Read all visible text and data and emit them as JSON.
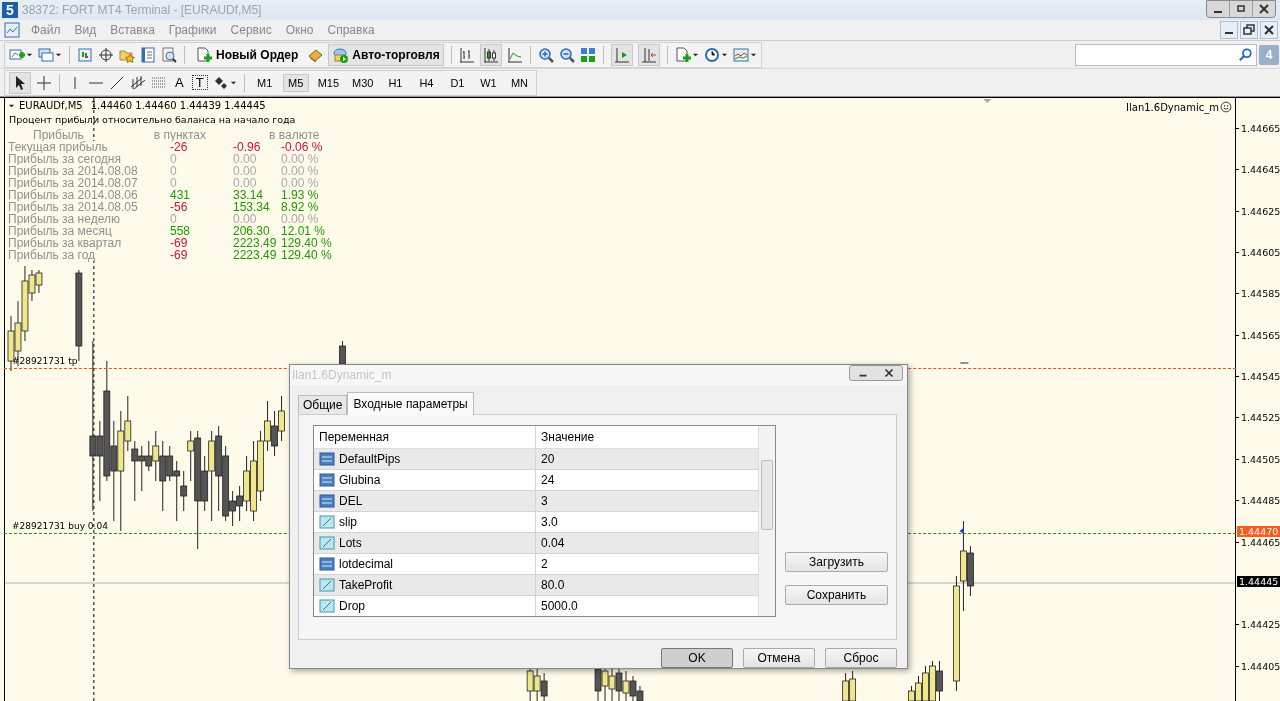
{
  "window": {
    "logo": "5",
    "title": "38372: FORT MT4 Terminal - [EURAUDf,M5]"
  },
  "menu": [
    "Файл",
    "Вид",
    "Вставка",
    "Графики",
    "Сервис",
    "Окно",
    "Справка"
  ],
  "toolbar": {
    "new_order": "Новый Ордер",
    "auto_trading": {
      "label": "Авто-торговля",
      "on": true
    },
    "messages_badge": "4"
  },
  "text_tools": [
    "A",
    "T"
  ],
  "timeframes": [
    {
      "label": "M1",
      "selected": false
    },
    {
      "label": "M5",
      "selected": true
    },
    {
      "label": "M15",
      "selected": false
    },
    {
      "label": "M30",
      "selected": false
    },
    {
      "label": "H1",
      "selected": false
    },
    {
      "label": "H4",
      "selected": false
    },
    {
      "label": "D1",
      "selected": false
    },
    {
      "label": "W1",
      "selected": false
    },
    {
      "label": "MN",
      "selected": false
    }
  ],
  "chart": {
    "symbol": "EURAUDf,M5",
    "ohlc": "1.44460 1.44460 1.44439 1.44445",
    "expert": "Ilan1.6Dynamic_m",
    "subtitle": "Процент прибыли относительно баланса на начало года",
    "profit_headers": [
      "Прибыль",
      "в пунктах",
      "в валюте"
    ],
    "profit_rows": [
      {
        "label": "Текущая прибыль",
        "cells": [
          {
            "text": "-26",
            "color": "#d0103a"
          },
          {
            "text": "-0.96",
            "color": "#d0103a"
          },
          {
            "text": "-0.06 %",
            "color": "#d0103a"
          }
        ]
      },
      {
        "label": "Прибыль за сегодня",
        "cells": [
          {
            "text": "0",
            "color": "#a8a8a8"
          },
          {
            "text": "0.00",
            "color": "#a8a8a8"
          },
          {
            "text": "0.00 %",
            "color": "#a8a8a8"
          }
        ]
      },
      {
        "label": "Прибыль за 2014.08.08",
        "cells": [
          {
            "text": "0",
            "color": "#a8a8a8"
          },
          {
            "text": "0.00",
            "color": "#a8a8a8"
          },
          {
            "text": "0.00 %",
            "color": "#a8a8a8"
          }
        ]
      },
      {
        "label": "Прибыль за 2014.08.07",
        "cells": [
          {
            "text": "0",
            "color": "#a8a8a8"
          },
          {
            "text": "0.00",
            "color": "#a8a8a8"
          },
          {
            "text": "0.00 %",
            "color": "#a8a8a8"
          }
        ]
      },
      {
        "label": "Прибыль за 2014.08.06",
        "cells": [
          {
            "text": "431",
            "color": "#1e9a00"
          },
          {
            "text": "33.14",
            "color": "#1e9a00"
          },
          {
            "text": "1.93 %",
            "color": "#1e9a00"
          }
        ]
      },
      {
        "label": "Прибыль за 2014.08.05",
        "cells": [
          {
            "text": "-56",
            "color": "#d0103a"
          },
          {
            "text": "153.34",
            "color": "#1e9a00"
          },
          {
            "text": "8.92 %",
            "color": "#1e9a00"
          }
        ]
      },
      {
        "label": "Прибыль за неделю",
        "cells": [
          {
            "text": "0",
            "color": "#a8a8a8"
          },
          {
            "text": "0.00",
            "color": "#a8a8a8"
          },
          {
            "text": "0.00 %",
            "color": "#a8a8a8"
          }
        ]
      },
      {
        "label": "Прибыль за месяц",
        "cells": [
          {
            "text": "558",
            "color": "#1e9a00"
          },
          {
            "text": "206.30",
            "color": "#1e9a00"
          },
          {
            "text": "12.01 %",
            "color": "#1e9a00"
          }
        ]
      },
      {
        "label": "Прибыль за квартал",
        "cells": [
          {
            "text": "-69",
            "color": "#d0103a"
          },
          {
            "text": "2223.49",
            "color": "#1e9a00"
          },
          {
            "text": "129.40 %",
            "color": "#1e9a00"
          }
        ]
      },
      {
        "label": "Прибыль за год",
        "cells": [
          {
            "text": "-69",
            "color": "#d0103a"
          },
          {
            "text": "2223.49",
            "color": "#1e9a00"
          },
          {
            "text": "129.40 %",
            "color": "#1e9a00"
          }
        ]
      }
    ],
    "order_lines": [
      {
        "label": "#28921731 tp",
        "color": "#f05020"
      },
      {
        "label": "#28921731 buy 0.04",
        "color": "#1e9a00"
      }
    ],
    "price_labels": [
      "1.44665",
      "1.44645",
      "1.44625",
      "1.44605",
      "1.44585",
      "1.44565",
      "1.44545",
      "1.44525",
      "1.44505",
      "1.44485",
      "1.44465",
      "1.44425",
      "1.44405"
    ],
    "price_tags": [
      {
        "text": "1.44470",
        "color": "#ff5a1e"
      },
      {
        "text": "1.44445",
        "color": "#000000"
      }
    ]
  },
  "dialog": {
    "title": "Ilan1.6Dynamic_m",
    "tabs": [
      {
        "label": "Общие",
        "selected": false
      },
      {
        "label": "Входные параметры",
        "selected": true
      }
    ],
    "columns": [
      "Переменная",
      "Значение"
    ],
    "rows": [
      {
        "kind": "int",
        "name": "DefaultPips",
        "value": "20"
      },
      {
        "kind": "int",
        "name": "Glubina",
        "value": "24"
      },
      {
        "kind": "int",
        "name": "DEL",
        "value": "3"
      },
      {
        "kind": "double",
        "name": "slip",
        "value": "3.0"
      },
      {
        "kind": "double",
        "name": "Lots",
        "value": "0.04"
      },
      {
        "kind": "int",
        "name": "lotdecimal",
        "value": "2"
      },
      {
        "kind": "double",
        "name": "TakeProfit",
        "value": "80.0"
      },
      {
        "kind": "double",
        "name": "Drop",
        "value": "5000.0"
      }
    ],
    "side_buttons": [
      "Загрузить",
      "Сохранить"
    ],
    "buttons": [
      {
        "label": "OK",
        "default": true
      },
      {
        "label": "Отмена",
        "default": false
      },
      {
        "label": "Сброс",
        "default": false
      }
    ]
  }
}
